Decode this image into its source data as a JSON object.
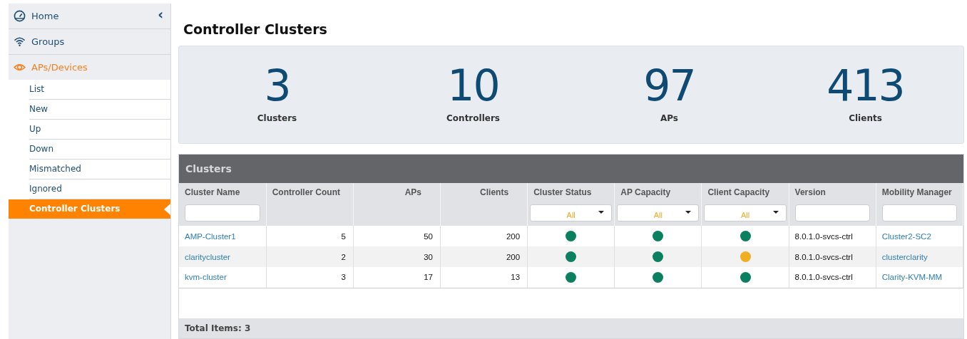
{
  "sidebar": {
    "collapse_glyph": "‹",
    "items": [
      {
        "label": "Home",
        "selected": false
      },
      {
        "label": "Groups",
        "selected": false
      },
      {
        "label": "APs/Devices",
        "selected": true,
        "children": [
          {
            "label": "List",
            "selected": false
          },
          {
            "label": "New",
            "selected": false
          },
          {
            "label": "Up",
            "selected": false
          },
          {
            "label": "Down",
            "selected": false
          },
          {
            "label": "Mismatched",
            "selected": false
          },
          {
            "label": "Ignored",
            "selected": false
          },
          {
            "label": "Controller Clusters",
            "selected": true
          }
        ]
      }
    ]
  },
  "page_title": "Controller Clusters",
  "stats": [
    {
      "value": "3",
      "label": "Clusters"
    },
    {
      "value": "10",
      "label": "Controllers"
    },
    {
      "value": "97",
      "label": "APs"
    },
    {
      "value": "413",
      "label": "Clients"
    }
  ],
  "table": {
    "title": "Clusters",
    "columns": [
      {
        "label": "Cluster Name",
        "kind": "text"
      },
      {
        "label": "Controller Count",
        "kind": "plain"
      },
      {
        "label": "APs",
        "kind": "plain"
      },
      {
        "label": "Clients",
        "kind": "plain"
      },
      {
        "label": "Cluster Status",
        "kind": "select",
        "filter_value": "All"
      },
      {
        "label": "AP Capacity",
        "kind": "select",
        "filter_value": "All"
      },
      {
        "label": "Client Capacity",
        "kind": "select",
        "filter_value": "All"
      },
      {
        "label": "Version",
        "kind": "text"
      },
      {
        "label": "Mobility Manager",
        "kind": "text"
      }
    ],
    "rows": [
      {
        "cluster_name": "AMP-Cluster1",
        "controller_count": "5",
        "aps": "50",
        "clients": "200",
        "cluster_status": {
          "color": "#0a8060"
        },
        "ap_capacity": {
          "color": "#0a8060"
        },
        "client_capacity": {
          "color": "#0a8060"
        },
        "version": "8.0.1.0-svcs-ctrl",
        "mobility_manager": "Cluster2-SC2"
      },
      {
        "cluster_name": "claritycluster",
        "controller_count": "2",
        "aps": "30",
        "clients": "200",
        "cluster_status": {
          "color": "#0a8060"
        },
        "ap_capacity": {
          "color": "#0a8060"
        },
        "client_capacity": {
          "color": "#f0ae22"
        },
        "version": "8.0.1.0-svcs-ctrl",
        "mobility_manager": "clusterclarity"
      },
      {
        "cluster_name": "kvm-cluster",
        "controller_count": "3",
        "aps": "17",
        "clients": "13",
        "cluster_status": {
          "color": "#0a8060"
        },
        "ap_capacity": {
          "color": "#0a8060"
        },
        "client_capacity": {
          "color": "#0a8060"
        },
        "version": "8.0.1.0-svcs-ctrl",
        "mobility_manager": "Clarity-KVM-MM"
      }
    ],
    "footer": "Total Items: 3"
  }
}
